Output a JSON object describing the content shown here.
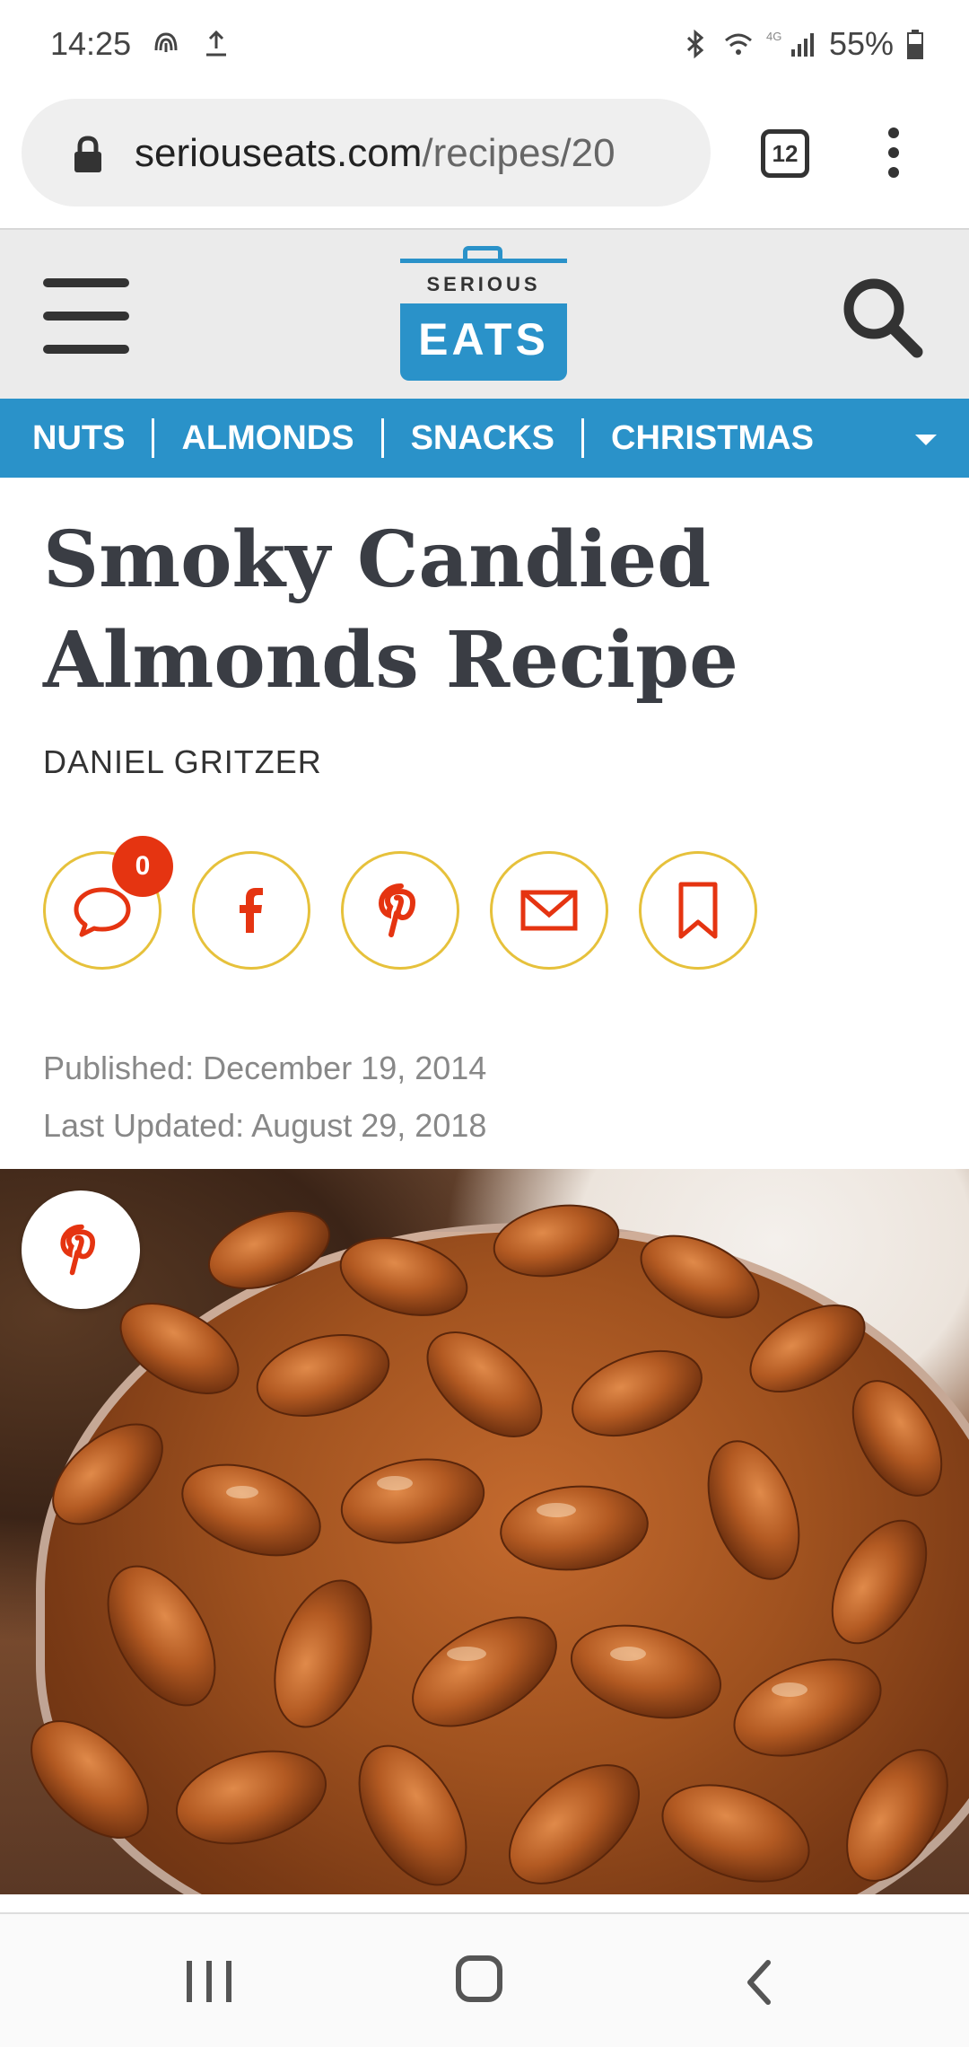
{
  "status_bar": {
    "time": "14:25",
    "battery": "55%",
    "icons_left": [
      "fingerprint-icon",
      "upload-icon"
    ],
    "icons_right": [
      "bluetooth-icon",
      "wifi-icon",
      "4g-signal-icon",
      "battery-icon"
    ],
    "network": "4G"
  },
  "browser": {
    "url_domain": "seriouseats.com",
    "url_path": "/recipes/20",
    "tab_count": "12"
  },
  "site": {
    "logo_top": "SERIOUS",
    "logo_bottom": "EATS",
    "brand_color": "#2a92c9"
  },
  "tags": [
    "NUTS",
    "ALMONDS",
    "SNACKS",
    "CHRISTMAS"
  ],
  "article": {
    "title": "Smoky Candied Almonds Recipe",
    "author": "DANIEL GRITZER",
    "comment_count": "0",
    "published": "Published: December 19, 2014",
    "updated": "Last Updated: August 29, 2018"
  },
  "share_buttons": [
    "comment-icon",
    "facebook-icon",
    "pinterest-icon",
    "email-icon",
    "bookmark-icon"
  ],
  "colors": {
    "accent_red": "#e53411",
    "ring_yellow": "#e6c13b"
  }
}
